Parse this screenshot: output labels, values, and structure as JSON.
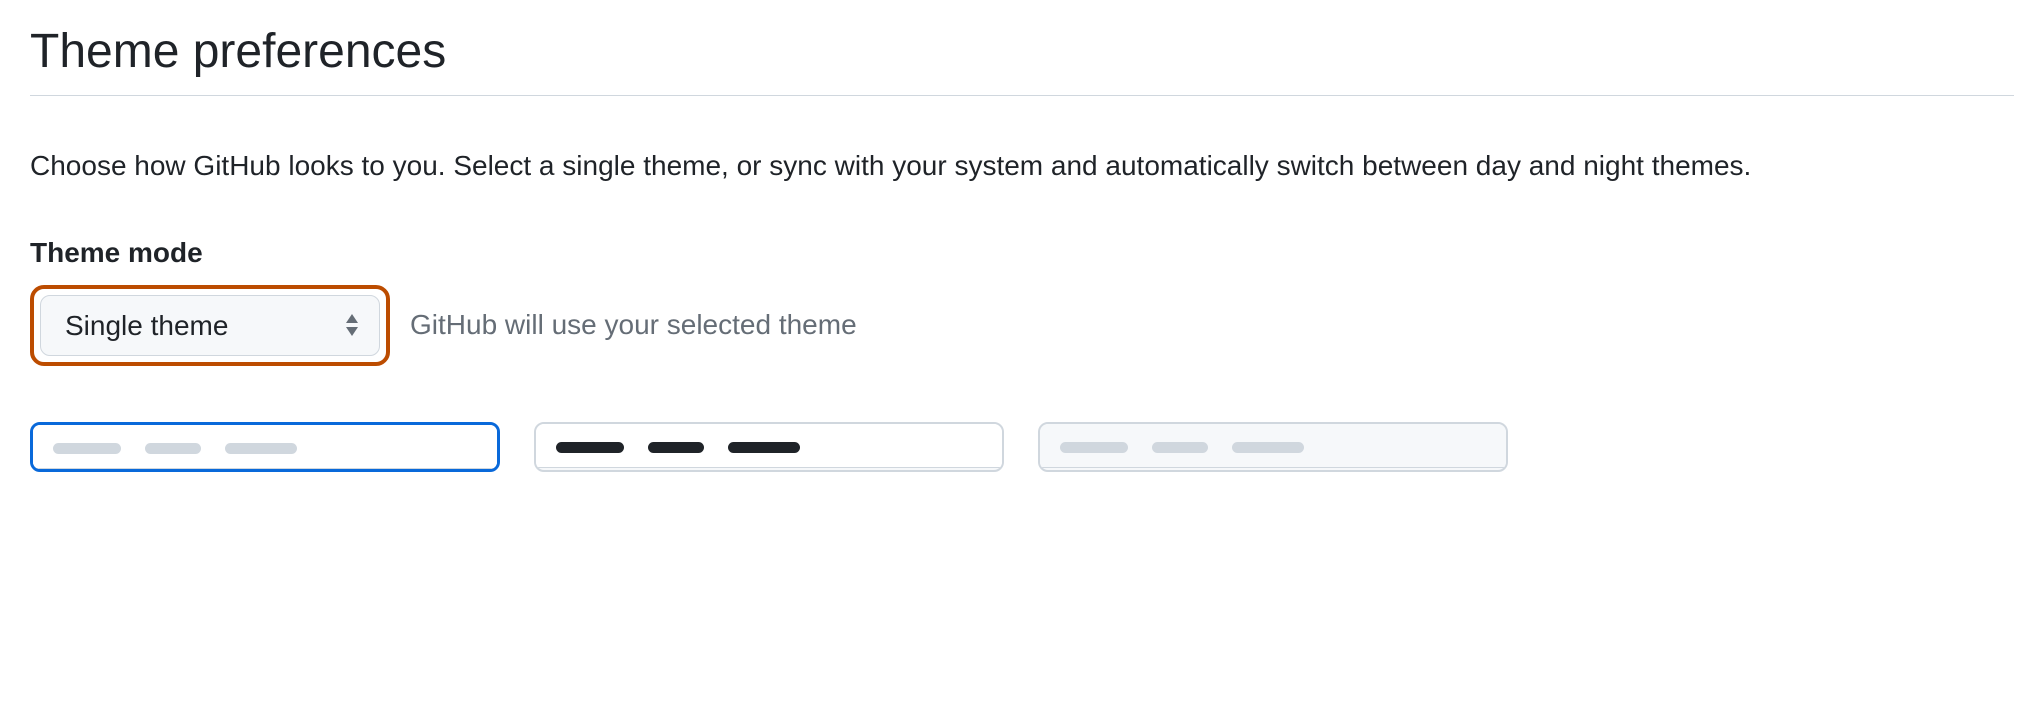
{
  "page": {
    "title": "Theme preferences",
    "description": "Choose how GitHub looks to you. Select a single theme, or sync with your system and automatically switch between day and night themes."
  },
  "theme_mode": {
    "label": "Theme mode",
    "selected": "Single theme",
    "hint": "GitHub will use your selected theme"
  },
  "theme_cards": [
    {
      "selected": true,
      "bar_style": "light"
    },
    {
      "selected": false,
      "bar_style": "dark"
    },
    {
      "selected": false,
      "bar_style": "light"
    }
  ]
}
